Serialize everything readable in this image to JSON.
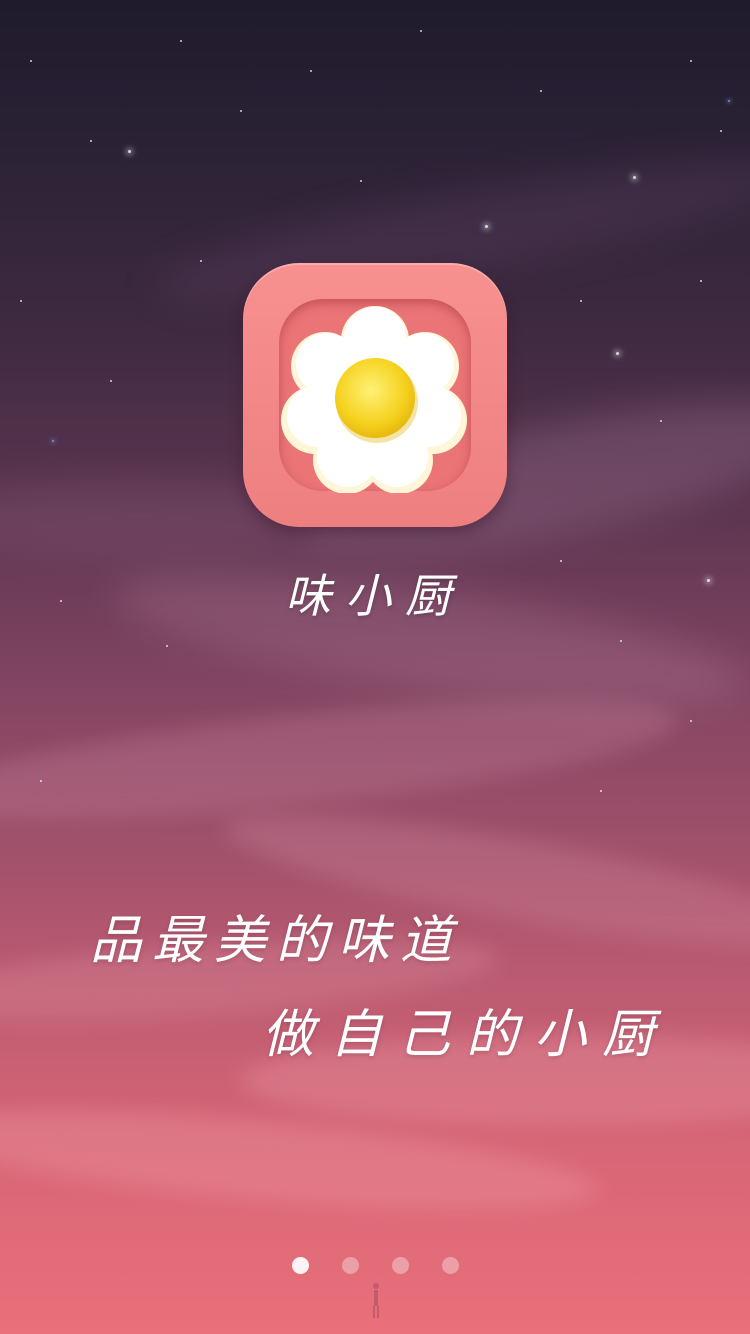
{
  "app": {
    "name": "味小厨"
  },
  "slogan": {
    "line1": "品最美的味道",
    "line2": "做自己的小厨"
  },
  "pager": {
    "total": 4,
    "active_index": 0
  },
  "icon": {
    "name": "fried-egg-flower-icon",
    "colors": {
      "tile": "#f7918f",
      "tile_inner": "#ea7476",
      "petals": "#ffffff",
      "yolk": "#f5d21f"
    }
  },
  "theme": {
    "sky_top": "#1f1a2c",
    "sky_bottom": "#ea707b"
  }
}
